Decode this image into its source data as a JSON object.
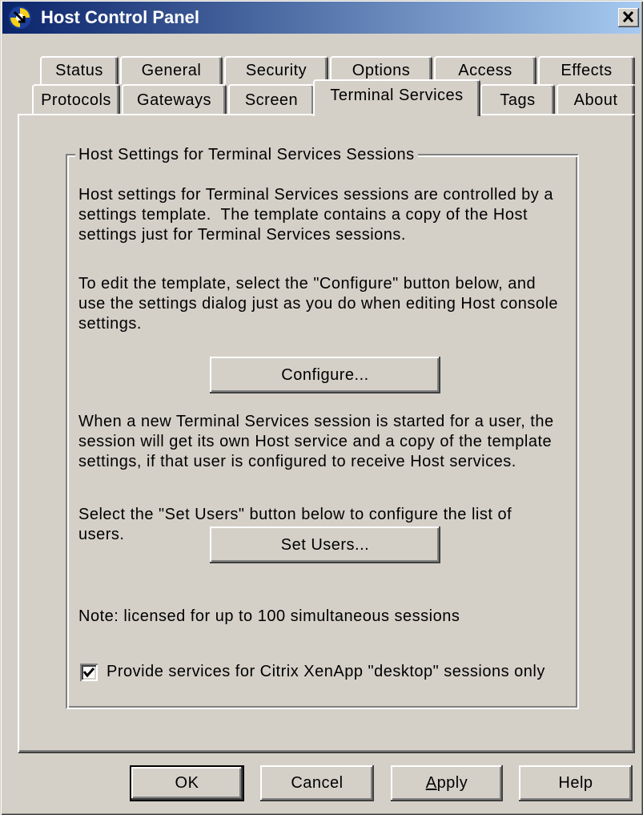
{
  "window": {
    "title": "Host Control Panel",
    "icon": "app-icon",
    "close_icon": "close-icon"
  },
  "tabs": {
    "row1": [
      {
        "label": "Status",
        "selected": false
      },
      {
        "label": "General",
        "selected": false
      },
      {
        "label": "Security",
        "selected": false
      },
      {
        "label": "Options",
        "selected": false
      },
      {
        "label": "Access",
        "selected": false
      },
      {
        "label": "Effects",
        "selected": false
      }
    ],
    "row2": [
      {
        "label": "Protocols",
        "selected": false
      },
      {
        "label": "Gateways",
        "selected": false
      },
      {
        "label": "Screen",
        "selected": false
      },
      {
        "label": "Terminal Services",
        "selected": true
      },
      {
        "label": "Tags",
        "selected": false
      },
      {
        "label": "About",
        "selected": false
      }
    ]
  },
  "terminal_services": {
    "group_title": "Host Settings for Terminal Services Sessions",
    "paragraphs": [
      {
        "lines": [
          "Host settings for Terminal Services sessions are controlled by a",
          "settings template.  The template contains a copy of the Host",
          "settings just for Terminal Services sessions."
        ]
      },
      {
        "lines": [
          "To edit the template, select the \"Configure\" button below, and",
          "use the settings dialog just as you do when editing Host console",
          "settings."
        ]
      },
      {
        "lines": [
          "When a new Terminal Services session is started for a user, the",
          "session will get its own Host service and a copy of the template",
          "settings, if that user is configured to receive Host services."
        ]
      },
      {
        "lines": [
          "Select the \"Set Users\" button below to configure the list of",
          "users."
        ]
      }
    ],
    "configure_button": "Configure...",
    "set_users_button": "Set Users...",
    "license_note": "Note: licensed for up to 100 simultaneous sessions",
    "desktop_only": {
      "label": "Provide services for Citrix XenApp \"desktop\" sessions only",
      "checked": true,
      "check_icon": "checkmark-icon"
    }
  },
  "buttons": {
    "ok": "OK",
    "cancel": "Cancel",
    "apply": "Apply",
    "help": "Help"
  },
  "colors": {
    "face": "#D4D0C8",
    "highlight": "#FFFFFF",
    "shadow": "#808080",
    "dark_shadow": "#404040",
    "title_start": "#0A246A",
    "title_end": "#A6CAF0",
    "title_text": "#FFFFFF",
    "text": "#000000",
    "field": "#FFFFFF"
  }
}
